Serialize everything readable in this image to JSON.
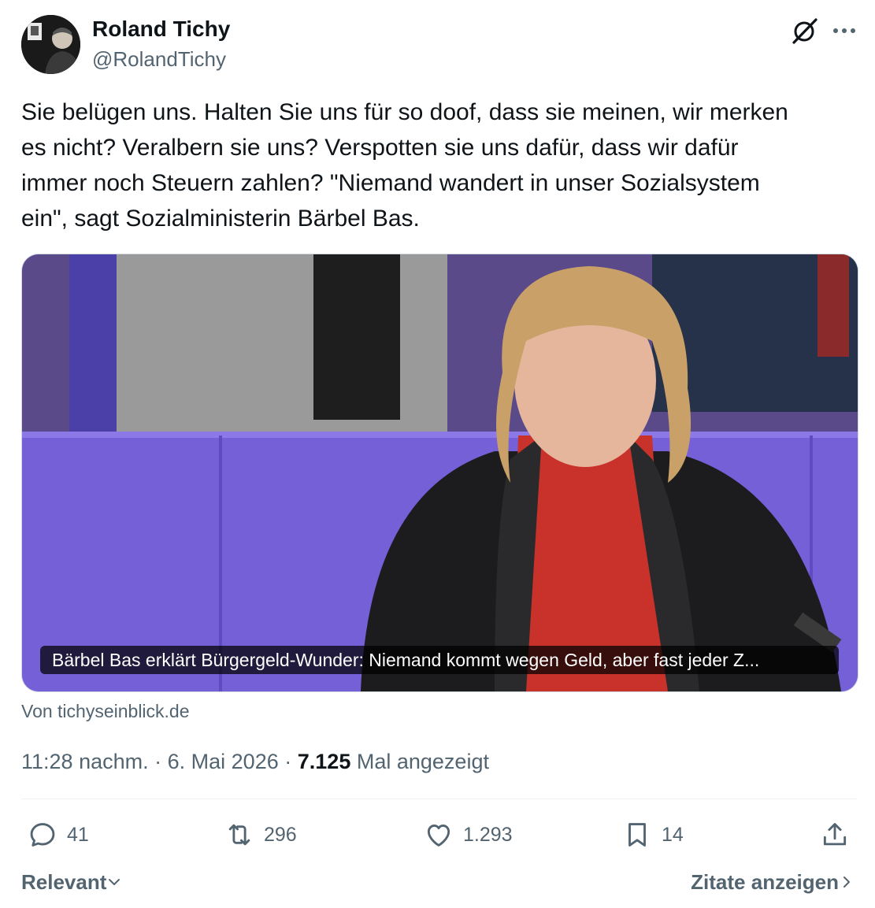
{
  "author": {
    "name": "Roland Tichy",
    "handle": "@RolandTichy"
  },
  "tweet": {
    "text": "Sie belügen uns. Halten Sie uns für so doof, dass sie meinen, wir merken\nes nicht? Veralbern sie uns? Verspotten sie uns dafür, dass wir dafür\nimmer noch Steuern zahlen? \"Niemand wandert in unser Sozialsystem\nein\", sagt Sozialministerin Bärbel Bas."
  },
  "link_card": {
    "caption": "Bärbel Bas erklärt Bürgergeld-Wunder: Niemand kommt wegen Geld, aber fast jeder Z...",
    "source": "Von tichyseinblick.de"
  },
  "meta": {
    "time": "11:28 nachm.",
    "date": "6. Mai 2026",
    "views": "7.125",
    "views_label": "Mal angezeigt",
    "separator": "·"
  },
  "actions": {
    "replies": "41",
    "reposts": "296",
    "likes": "1.293",
    "bookmarks": "14"
  },
  "footer": {
    "sort_label": "Relevant",
    "quotes_label": "Zitate anzeigen"
  },
  "icons": {
    "grok": "grok-icon",
    "more": "more-icon",
    "reply": "reply-icon",
    "repost": "repost-icon",
    "like": "like-icon",
    "bookmark": "bookmark-icon",
    "share": "share-icon"
  },
  "colors": {
    "text": "#0f1419",
    "secondary": "#536471",
    "divider": "#eff3f4"
  }
}
